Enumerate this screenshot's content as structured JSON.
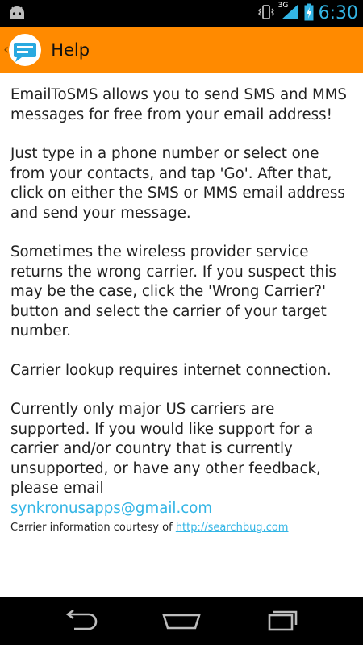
{
  "status_bar": {
    "time": "6:30",
    "network": "3G",
    "icons": [
      "android-notification-icon",
      "vibrate-icon",
      "signal-icon",
      "battery-charging-icon"
    ]
  },
  "action_bar": {
    "title": "Help",
    "background_color": "#ff8a00",
    "icons": [
      "up-chevron-icon",
      "app-message-icon"
    ]
  },
  "content": {
    "paragraphs": [
      "EmailToSMS allows you to send SMS and MMS messages for free from your email address!",
      "Just type in a phone number or select one from your contacts, and tap 'Go'. After that, click on either the SMS or MMS email address and send your message.",
      "Sometimes the wireless provider service returns the wrong carrier. If you suspect this may be the case, click the 'Wrong Carrier?' button and select the carrier of your target number.",
      "Carrier lookup requires internet connection."
    ],
    "support": {
      "text": "Currently only major US carriers are supported. If you would like support for a carrier and/or country that is currently unsupported, or have any other feedback, please email",
      "email": "synkronusapps@gmail.com"
    },
    "credit": {
      "text": "Carrier information courtesy of",
      "link": "http://searchbug.com"
    },
    "link_color": "#33b5e5"
  },
  "nav_bar": {
    "buttons": [
      "back-icon",
      "home-icon",
      "recent-apps-icon"
    ]
  }
}
